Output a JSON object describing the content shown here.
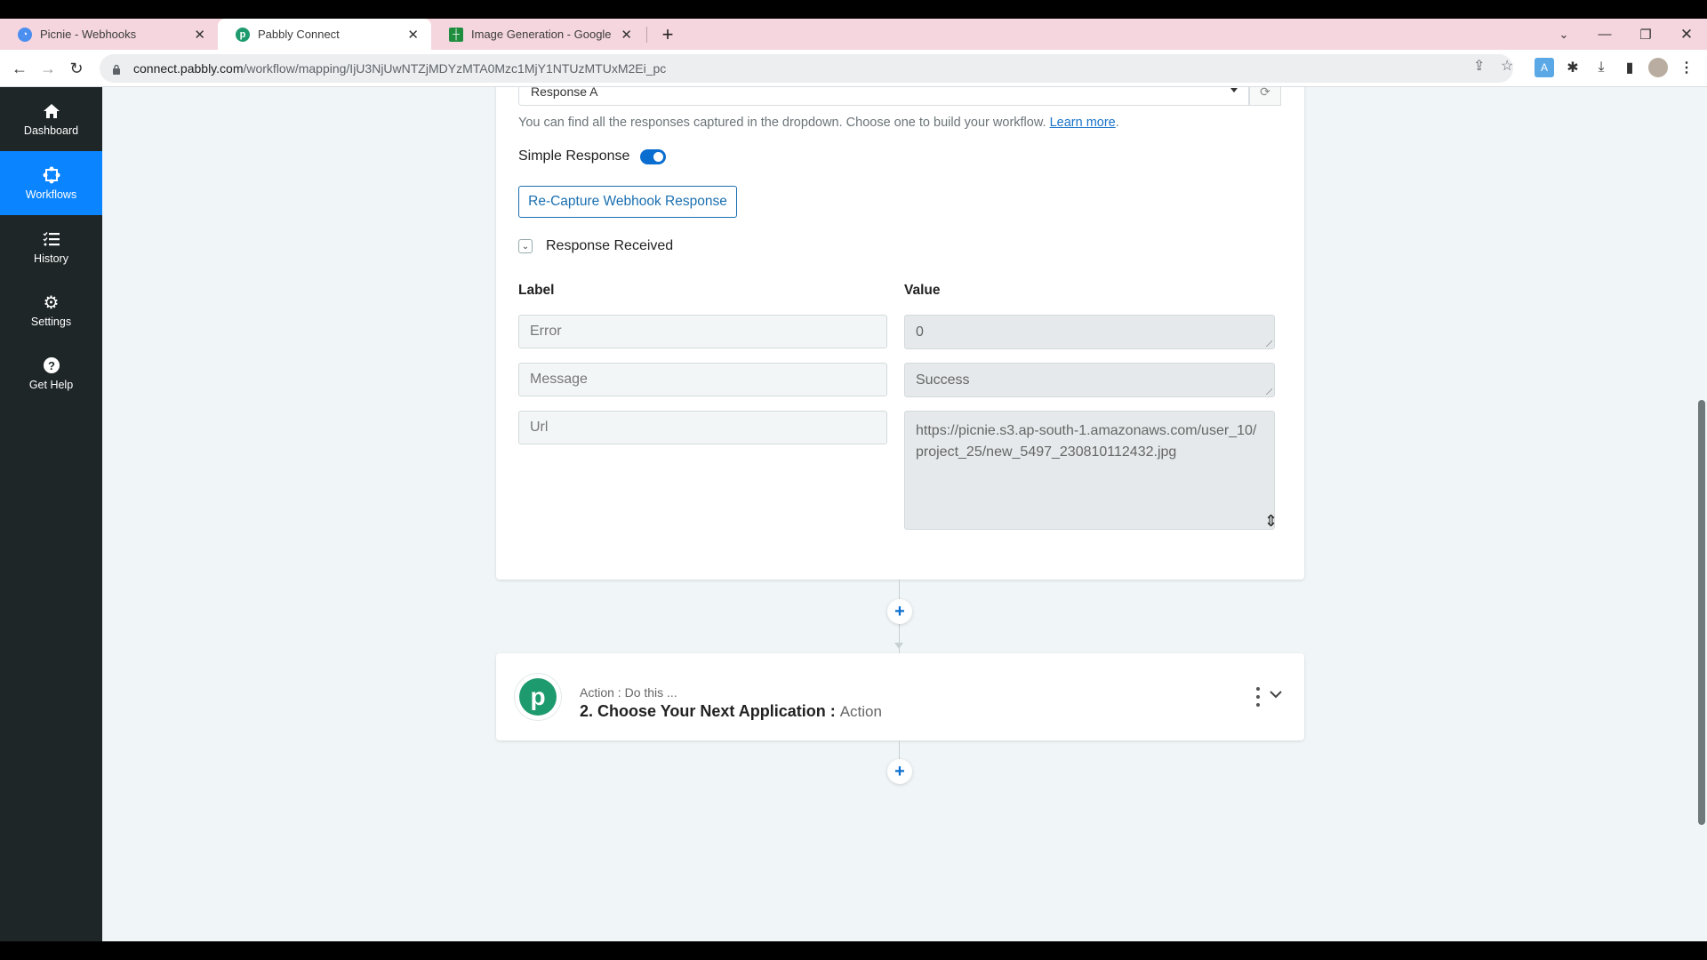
{
  "browser": {
    "tabs": [
      {
        "title": "Picnie - Webhooks",
        "favicon": "picnie-icon",
        "favicon_color": "#4a8ef0",
        "active": false
      },
      {
        "title": "Pabbly Connect",
        "favicon": "pabbly-icon",
        "favicon_color": "#1e9b6e",
        "active": true
      },
      {
        "title": "Image Generation - Google Shee",
        "favicon": "google-sheets-icon",
        "favicon_color": "#1e8e3e",
        "active": false
      }
    ],
    "new_tab_label": "+",
    "url_host": "connect.pabbly.com",
    "url_path": "/workflow/mapping/IjU3NjUwNTZjMDYzMTA0Mzc1MjY1NTUzMTUxM2Ei_pc"
  },
  "sidebar": {
    "items": [
      {
        "label": "Dashboard",
        "icon": "home-icon",
        "active": false
      },
      {
        "label": "Workflows",
        "icon": "workflow-icon",
        "active": true
      },
      {
        "label": "History",
        "icon": "history-list-icon",
        "active": false
      },
      {
        "label": "Settings",
        "icon": "gear-icon",
        "active": false
      },
      {
        "label": "Get Help",
        "icon": "help-icon",
        "active": false
      }
    ]
  },
  "trigger_card": {
    "response_select_value": "Response A",
    "help_text": "You can find all the responses captured in the dropdown. Choose one to build your workflow.",
    "learn_more": "Learn more",
    "simple_response_label": "Simple Response",
    "simple_response_on": true,
    "recapture_button": "Re-Capture Webhook Response",
    "response_received_label": "Response Received",
    "label_header": "Label",
    "value_header": "Value",
    "rows": [
      {
        "label": "Error",
        "value": "0"
      },
      {
        "label": "Message",
        "value": "Success"
      },
      {
        "label": "Url",
        "value": "https://picnie.s3.ap-south-1.amazonaws.com/user_10/project_25/new_5497_230810112432.jpg"
      }
    ]
  },
  "action_card": {
    "subtitle": "Action : Do this ...",
    "title": "2. Choose Your Next Application :",
    "title_suffix": "Action",
    "app_logo_letter": "p"
  },
  "add_step_label": "+"
}
